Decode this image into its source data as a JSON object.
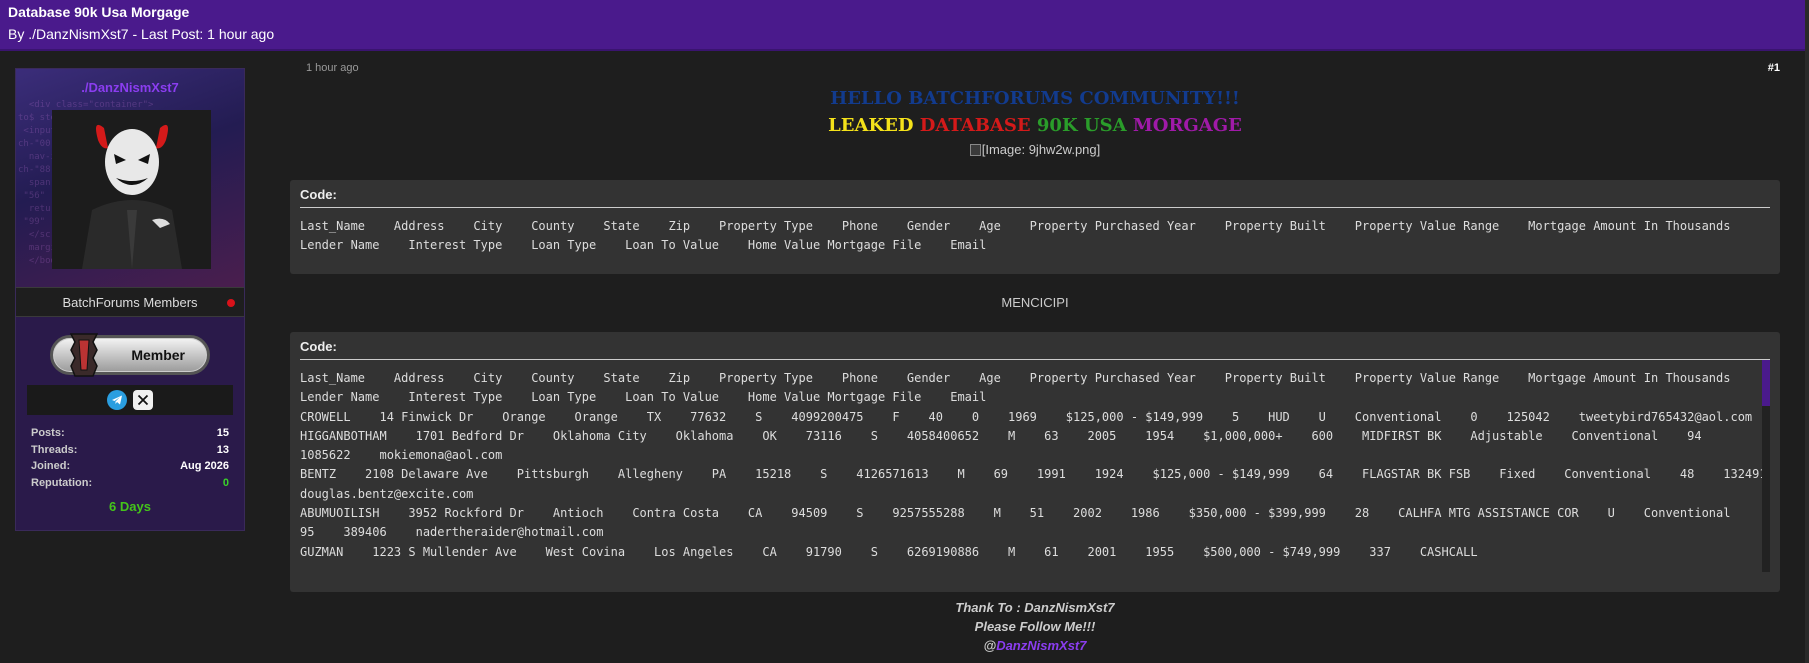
{
  "thread": {
    "title": "Database 90k Usa Morgage",
    "byline": "By ./DanzNismXst7 - Last Post: 1 hour ago"
  },
  "author": {
    "username": "./DanzNismXst7",
    "usergroup": "BatchForums Members",
    "rank": "Member",
    "stats": [
      {
        "label": "Posts:",
        "value": "15"
      },
      {
        "label": "Threads:",
        "value": "13"
      },
      {
        "label": "Joined:",
        "value": "Aug 2026"
      },
      {
        "label": "Reputation:",
        "value": "0"
      }
    ],
    "active_days": "6 Days",
    "colors": {
      "username": "#8b3df0",
      "reputation": "#3ad12a",
      "online": "#d9121a"
    },
    "icons": [
      "telegram-icon",
      "x-icon",
      "rank-icon"
    ]
  },
  "post": {
    "time": "1 hour ago",
    "number": "#1",
    "greeting": "HELLO BATCHFORUMS COMMUNITY!!!",
    "headline": [
      {
        "text": "LEAKED",
        "color": "#f5e21a"
      },
      {
        "text": "DATABASE",
        "color": "#d41a1a"
      },
      {
        "text": "90K",
        "color": "#2a9d2a"
      },
      {
        "text": "USA",
        "color": "#2a9d2a"
      },
      {
        "text": "MORGAGE",
        "color": "#a01aa8"
      }
    ],
    "image_alt": "[Image: 9jhw2w.png]",
    "code1_label": "Code:",
    "code1_text": "Last_Name    Address    City    County    State    Zip    Property Type    Phone    Gender    Age    Property Purchased Year    Property Built    Property Value Range    Mortgage Amount In Thousands    Lender Name    Interest Type    Loan Type    Loan To Value    Home Value Mortgage File    Email",
    "middle_text": "MENCICIPI",
    "code2_label": "Code:",
    "code2_text": "Last_Name    Address    City    County    State    Zip    Property Type    Phone    Gender    Age    Property Purchased Year    Property Built    Property Value Range    Mortgage Amount In Thousands    Lender Name    Interest Type    Loan Type    Loan To Value    Home Value Mortgage File    Email\nCROWELL    14 Finwick Dr    Orange    Orange    TX    77632    S    4099200475    F    40    0    1969    $125,000 - $149,999    5    HUD    U    Conventional    0    125042    tweetybird765432@aol.com\nHIGGANBOTHAM    1701 Bedford Dr    Oklahoma City    Oklahoma    OK    73116    S    4058400652    M    63    2005    1954    $1,000,000+    600    MIDFIRST BK    Adjustable    Conventional    94    1085622    mokiemona@aol.com\nBENTZ    2108 Delaware Ave    Pittsburgh    Allegheny    PA    15218    S    4126571613    M    69    1991    1924    $125,000 - $149,999    64    FLAGSTAR BK FSB    Fixed    Conventional    48    132491    douglas.bentz@excite.com\nABUMUOILISH    3952 Rockford Dr    Antioch    Contra Costa    CA    94509    S    9257555288    M    51    2002    1986    $350,000 - $399,999    28    CALHFA MTG ASSISTANCE COR    U    Conventional    95    389406    nadertheraider@hotmail.com\nGUZMAN    1223 S Mullender Ave    West Covina    Los Angeles    CA    91790    S    6269190886    M    61    2001    1955    $500,000 - $749,999    337    CASHCALL",
    "thanks_line": "Thank To : DanzNismXst7",
    "follow_line": "Please Follow Me!!!",
    "at_sign": "@",
    "handle": "DanzNismXst7"
  }
}
